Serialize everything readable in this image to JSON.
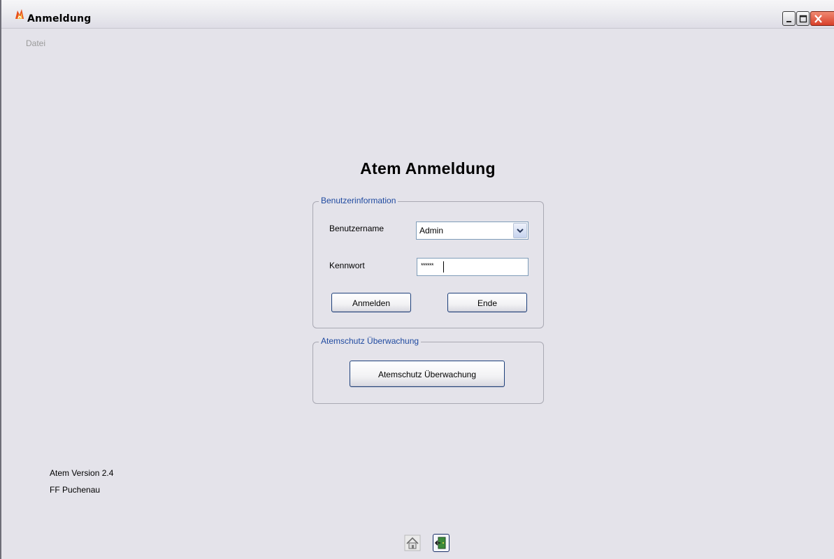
{
  "window": {
    "title": "Anmeldung",
    "controls": [
      "minimize-icon",
      "maximize-icon",
      "close-icon"
    ]
  },
  "menu": {
    "items": [
      "Datei"
    ]
  },
  "login": {
    "heading": "Atem Anmeldung",
    "user_group_label": "Benutzerinformation",
    "username_label": "Benutzername",
    "username_value": "Admin",
    "password_label": "Kennwort",
    "password_value": "******",
    "login_button": "Anmelden",
    "end_button": "Ende"
  },
  "monitor": {
    "group_label": "Atemschutz Überwachung",
    "button": "Atemschutz Überwachung"
  },
  "footer": {
    "version": "Atem Version 2.4",
    "org": "FF Puchenau"
  },
  "toolbar": {
    "icons": [
      "home-icon",
      "exit-door-icon"
    ]
  },
  "colors": {
    "window_bg": "#e4e3ea",
    "group_label": "#1f4aa0",
    "button_border": "#1c3f7a",
    "close_button": "#d8402a"
  }
}
